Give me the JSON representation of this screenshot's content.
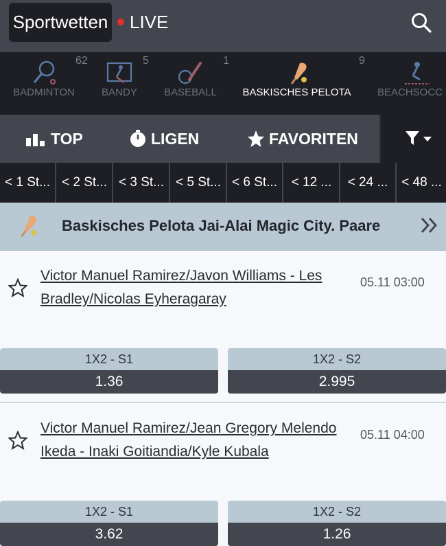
{
  "header": {
    "brand": "Sportwetten",
    "live": "LIVE",
    "live_color": "#e0312b"
  },
  "sports": [
    {
      "label": "BADMINTON",
      "count": "62",
      "icon": "badminton-icon"
    },
    {
      "label": "BANDY",
      "count": "5",
      "icon": "bandy-icon"
    },
    {
      "label": "BASEBALL",
      "count": "1",
      "icon": "baseball-icon"
    },
    {
      "label": "BASKISCHES PELOTA",
      "count": "9",
      "icon": "pelota-icon",
      "active": true
    },
    {
      "label": "BEACHSOCC",
      "count": "",
      "icon": "beach-soccer-icon"
    }
  ],
  "tabs": {
    "top": "TOP",
    "leagues": "LIGEN",
    "favorites": "FAVORITEN"
  },
  "time_filters": [
    "< 1 St...",
    "< 2 St...",
    "< 3 St...",
    "< 5 St...",
    "< 6 St...",
    "< 12 ...",
    "< 24 ...",
    "< 48 ..."
  ],
  "league": {
    "title": "Baskisches Pelota Jai-Alai Magic City. Paare"
  },
  "events": [
    {
      "teams": "Victor Manuel Ramirez/Javon Williams - Les Bradley/Nicolas Eyheragaray",
      "time": "05.11 03:00",
      "odds": [
        {
          "label": "1X2 - S1",
          "value": "1.36"
        },
        {
          "label": "1X2 - S2",
          "value": "2.995"
        }
      ]
    },
    {
      "teams": "Victor Manuel Ramirez/Jean Gregory Melendo Ikeda - Inaki Goitiandia/Kyle Kubala",
      "time": "05.11 04:00",
      "odds": [
        {
          "label": "1X2 - S1",
          "value": "3.62"
        },
        {
          "label": "1X2 - S2",
          "value": "1.26"
        }
      ]
    }
  ]
}
